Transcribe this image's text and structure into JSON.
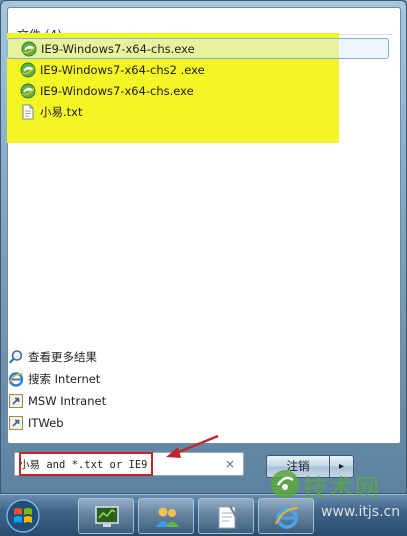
{
  "results": {
    "section_title": "文件 (4)",
    "files": [
      {
        "label": "IE9-Windows7-x64-chs.exe",
        "icon": "ie-installer-icon",
        "selected": true
      },
      {
        "label": "IE9-Windows7-x64-chs2 .exe",
        "icon": "ie-installer-icon",
        "selected": false
      },
      {
        "label": "IE9-Windows7-x64-chs.exe",
        "icon": "ie-installer-icon",
        "selected": false
      },
      {
        "label": "小易.txt",
        "icon": "text-file-icon",
        "selected": false
      }
    ]
  },
  "more": {
    "items": [
      {
        "label": "查看更多结果",
        "icon": "magnifier-icon"
      },
      {
        "label": "搜索 Internet",
        "icon": "internet-explorer-icon"
      },
      {
        "label": "MSW Intranet",
        "icon": "shortcut-icon"
      },
      {
        "label": "ITWeb",
        "icon": "shortcut-icon"
      }
    ]
  },
  "search": {
    "value": "小易 and *.txt or IE9",
    "clear_glyph": "×"
  },
  "power": {
    "label": "注销",
    "arrow_glyph": "▸"
  },
  "taskbar": {
    "buttons": [
      "monitor-app-icon",
      "users-app-icon",
      "notepad-app-icon",
      "internet-explorer-icon"
    ]
  },
  "watermark": {
    "title": "技术网",
    "url": "www.itjs.cn"
  },
  "colors": {
    "highlight": "#f4f524",
    "annotation": "#c0262a",
    "section_title": "#1e3287"
  }
}
